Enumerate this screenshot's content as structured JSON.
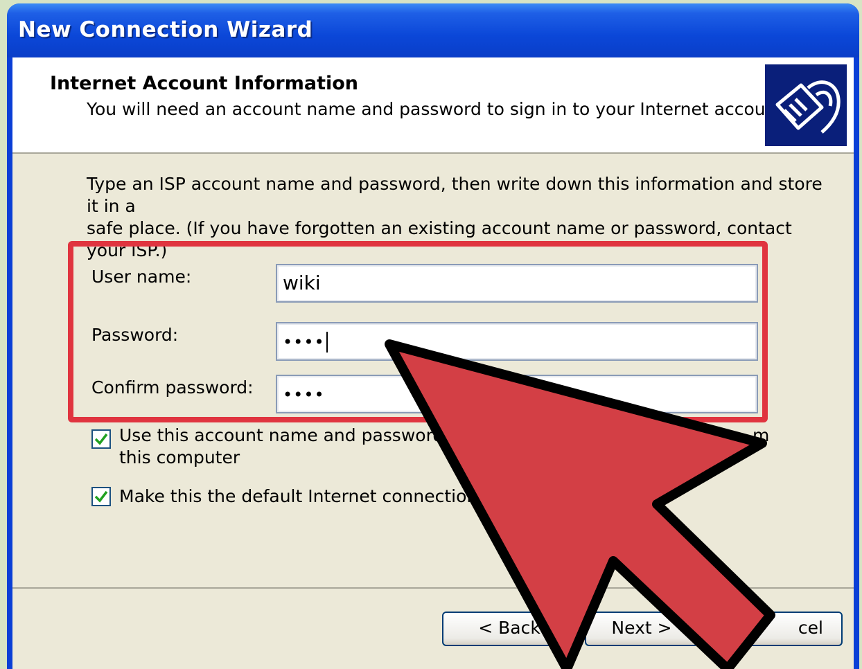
{
  "window": {
    "title": "New Connection Wizard"
  },
  "header": {
    "title": "Internet Account Information",
    "subtitle": "You will need an account name and password to sign in to your Internet account.",
    "icon": "network-cable-icon"
  },
  "instruction": {
    "line1": "Type an ISP account name and password, then write down this information and store it in a",
    "line2": "safe place. (If you have forgotten an existing account name or password, contact your ISP.)"
  },
  "fields": {
    "username_label": "User name:",
    "username_value": "wiki",
    "password_label": "Password:",
    "password_value": "••••",
    "confirm_label": "Confirm password:",
    "confirm_value": "••••"
  },
  "options": {
    "use_account_line1_a": "Use this account  name and password",
    "use_account_line1_b": "m",
    "use_account_line2": "this computer",
    "use_account_checked": true,
    "default_connection": "Make this the default Internet connection",
    "default_connection_checked": true
  },
  "buttons": {
    "back": "< Back",
    "next": "Next >",
    "cancel": "cel"
  },
  "colors": {
    "title_bar": "#0a3fd6",
    "highlight": "#e0343f",
    "arrow_fill": "#d33f45"
  }
}
